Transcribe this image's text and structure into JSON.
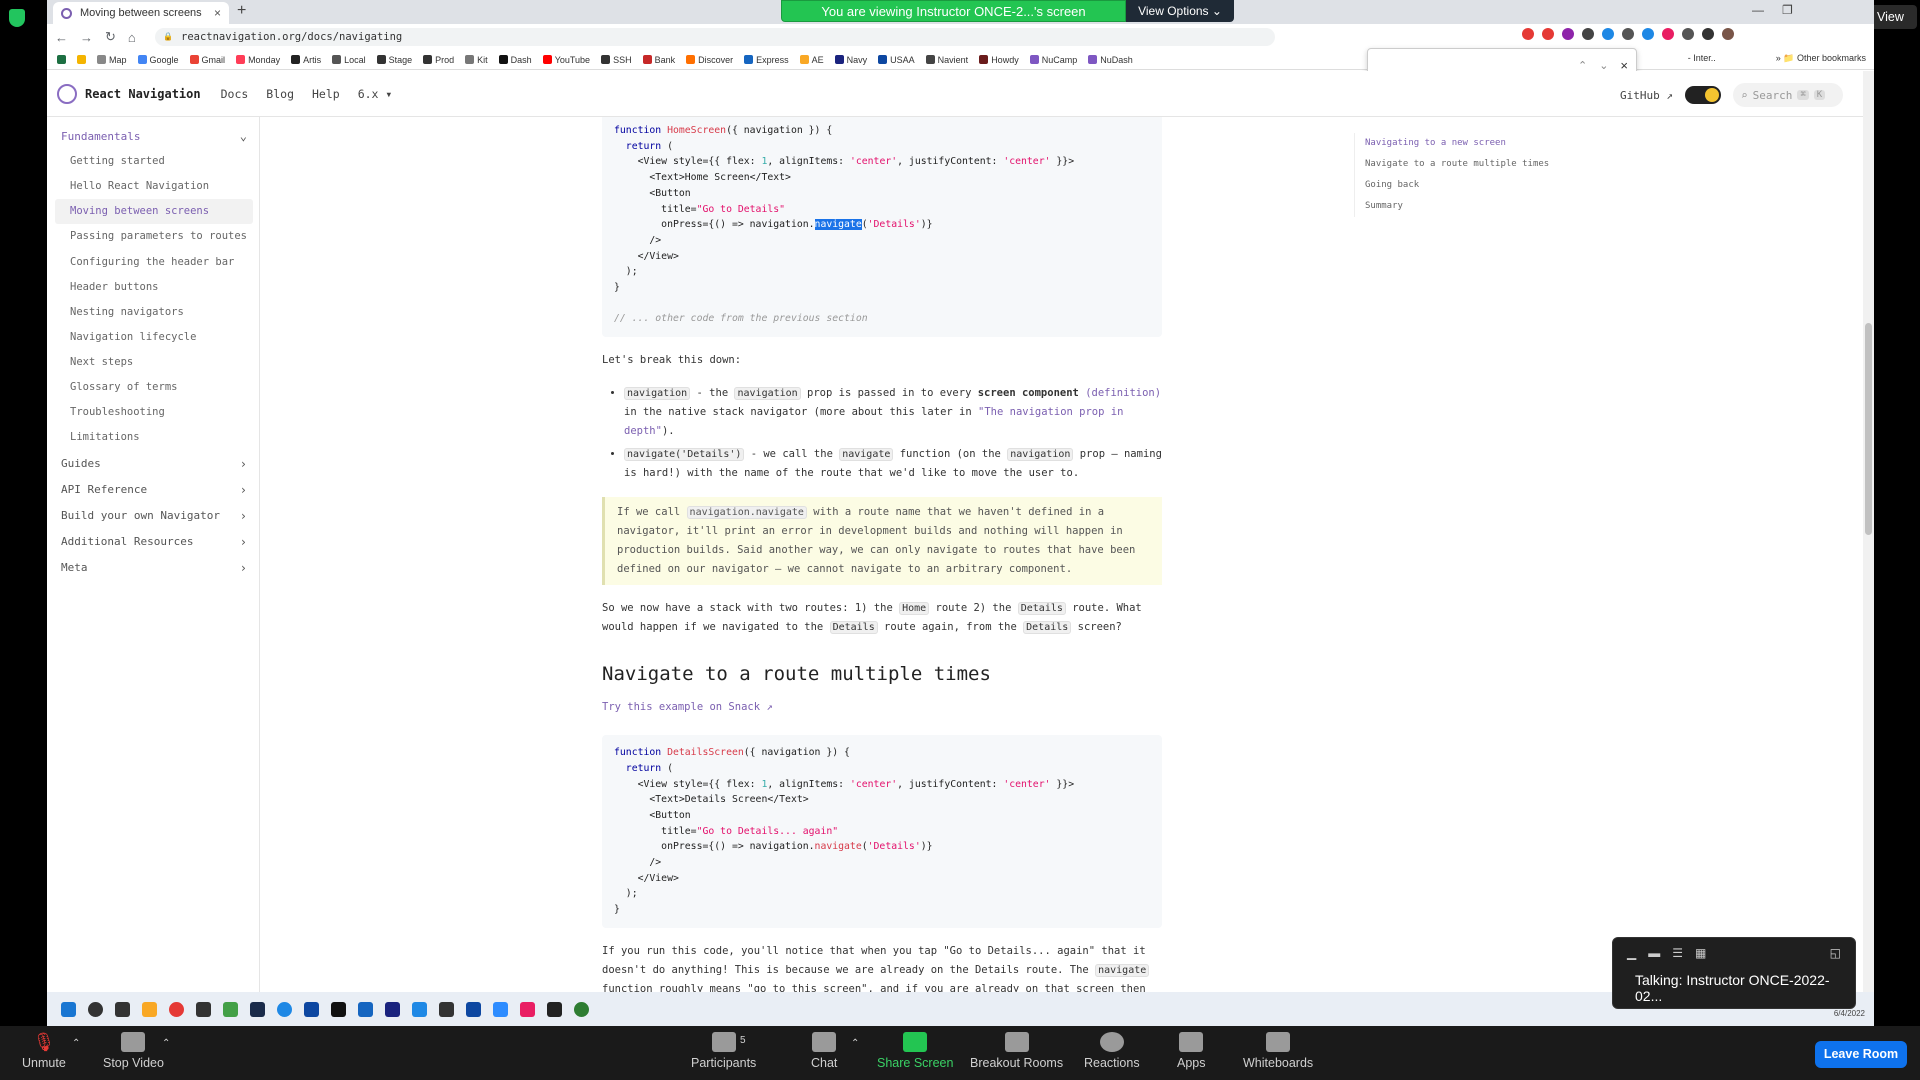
{
  "browser": {
    "tab_title": "Moving between screens",
    "url": "reactnavigation.org/docs/navigating",
    "bookmarks": [
      "Map",
      "Google",
      "Gmail",
      "Monday",
      "Artis",
      "Local",
      "Stage",
      "Prod",
      "Kit",
      "Dash",
      "YouTube",
      "SSH",
      "Bank",
      "Discover",
      "Express",
      "AE",
      "Navy",
      "USAA",
      "Navient",
      "Howdy",
      "NuCamp",
      "NuDash"
    ],
    "bookmark_overflow": "- Inter..",
    "other_bookmarks": "Other bookmarks"
  },
  "zoom_share": {
    "banner": "You are viewing Instructor ONCE-2...'s screen",
    "view_options": "View Options"
  },
  "site": {
    "brand": "React Navigation",
    "nav": [
      "Docs",
      "Blog",
      "Help"
    ],
    "version": "6.x",
    "github": "GitHub",
    "search": "Search",
    "search_key1": "⌘",
    "search_key2": "K"
  },
  "sidebar": {
    "section": "Fundamentals",
    "items": [
      "Getting started",
      "Hello React Navigation",
      "Moving between screens",
      "Passing parameters to routes",
      "Configuring the header bar",
      "Header buttons",
      "Nesting navigators",
      "Navigation lifecycle",
      "Next steps",
      "Glossary of terms",
      "Troubleshooting",
      "Limitations"
    ],
    "groups": [
      "Guides",
      "API Reference",
      "Build your own Navigator",
      "Additional Resources",
      "Meta"
    ]
  },
  "toc": [
    "Navigating to a new screen",
    "Navigate to a route multiple times",
    "Going back",
    "Summary"
  ],
  "content": {
    "code1_comment": "// ... other code from the previous section",
    "p_break": "Let's break this down:",
    "b1_a": "navigation",
    "b1_b": " - the ",
    "b1_c": "navigation",
    "b1_d": " prop is passed in to every ",
    "b1_e": "screen component",
    "b1_f": "(definition)",
    "b1_g": " in the native stack navigator (more about this later in ",
    "b1_h": "\"The navigation prop in depth\"",
    "b1_i": ").",
    "b2_a": "navigate('Details')",
    "b2_b": " - we call the ",
    "b2_c": "navigate",
    "b2_d": " function (on the ",
    "b2_e": "navigation",
    "b2_f": " prop — naming is hard!) with the name of the route that we'd like to move the user to.",
    "note_a": "If we call ",
    "note_b": "navigation.navigate",
    "note_c": " with a route name that we haven't defined in a navigator, it'll print an error in development builds and nothing will happen in production builds. Said another way, we can only navigate to routes that have been defined on our navigator — we cannot navigate to an arbitrary component.",
    "p2_a": "So we now have a stack with two routes: 1) the ",
    "p2_b": "Home",
    "p2_c": " route 2) the ",
    "p2_d": "Details",
    "p2_e": " route. What would happen if we navigated to the ",
    "p2_f": "Details",
    "p2_g": " route again, from the ",
    "p2_h": "Details",
    "p2_i": " screen?",
    "heading": "Navigate to a route multiple times",
    "snack": "Try this example on Snack",
    "p3_a": "If you run this code, you'll notice that when you tap \"Go to Details... again\" that it doesn't do anything! This is because we are already on the Details route. The ",
    "p3_b": "navigate",
    "p3_c": " function roughly means \"go to this screen\", and if you are already on that screen then it makes sense that it would do nothing."
  },
  "zoom_bar": {
    "items": [
      "Unmute",
      "Stop Video",
      "Participants",
      "Chat",
      "Share Screen",
      "Breakout Rooms",
      "Reactions",
      "Apps",
      "Whiteboards"
    ],
    "participants_count": "5",
    "leave": "Leave Room",
    "view": "View",
    "talking": "Talking: Instructor ONCE-2022-02..."
  },
  "taskbar": {
    "date": "6/4/2022"
  }
}
